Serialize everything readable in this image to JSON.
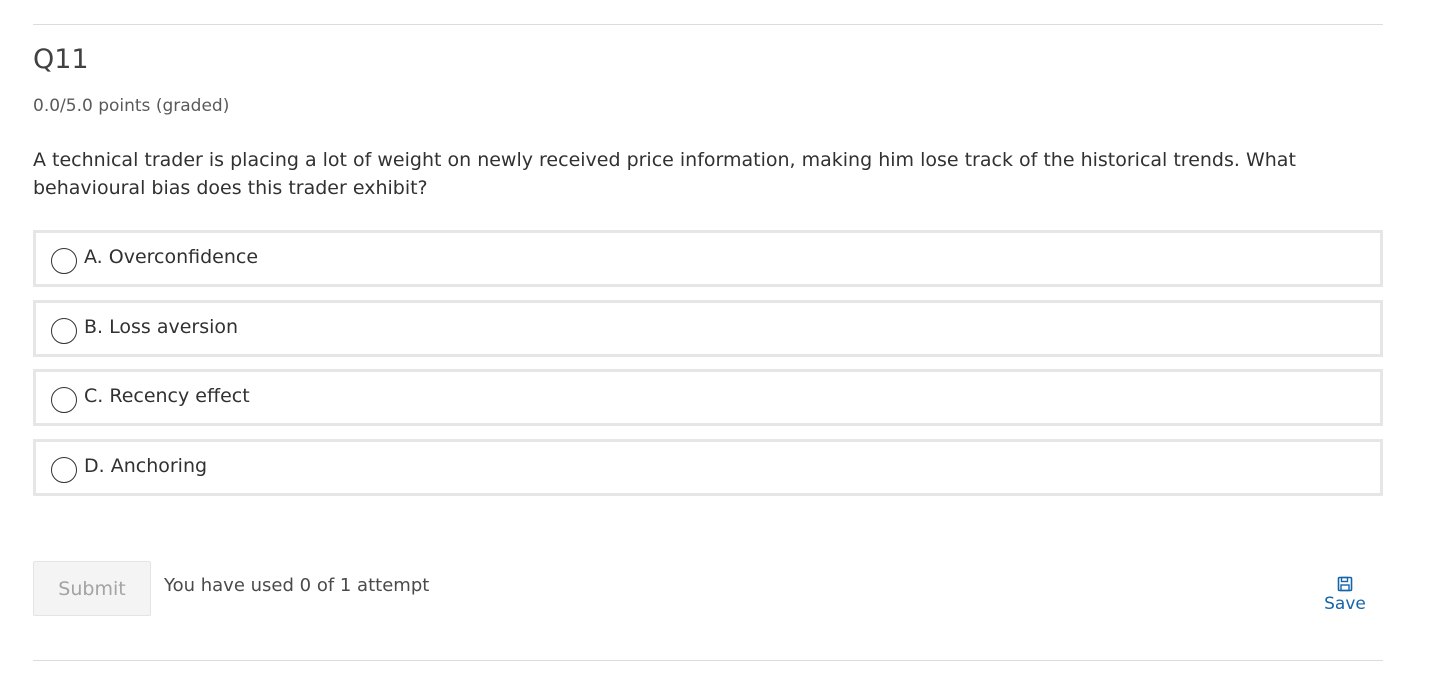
{
  "problem": {
    "title": "Q11",
    "points": "0.0/5.0 points (graded)",
    "question": "A technical trader is placing a lot of weight on newly received price information, making him lose track of the historical trends. What behavioural bias does this trader exhibit?"
  },
  "choices": [
    {
      "label": "A. Overconfidence",
      "selected": false
    },
    {
      "label": "B. Loss aversion",
      "selected": false
    },
    {
      "label": "C. Recency effect",
      "selected": false
    },
    {
      "label": "D. Anchoring",
      "selected": false
    }
  ],
  "actions": {
    "submit_label": "Submit",
    "attempts_text": "You have used 0 of 1 attempt",
    "save_label": "Save",
    "save_icon": "floppy-disk-icon"
  },
  "colors": {
    "link": "#1565a8",
    "border": "#e6e6e6",
    "submit_disabled_bg": "#f4f4f4"
  }
}
